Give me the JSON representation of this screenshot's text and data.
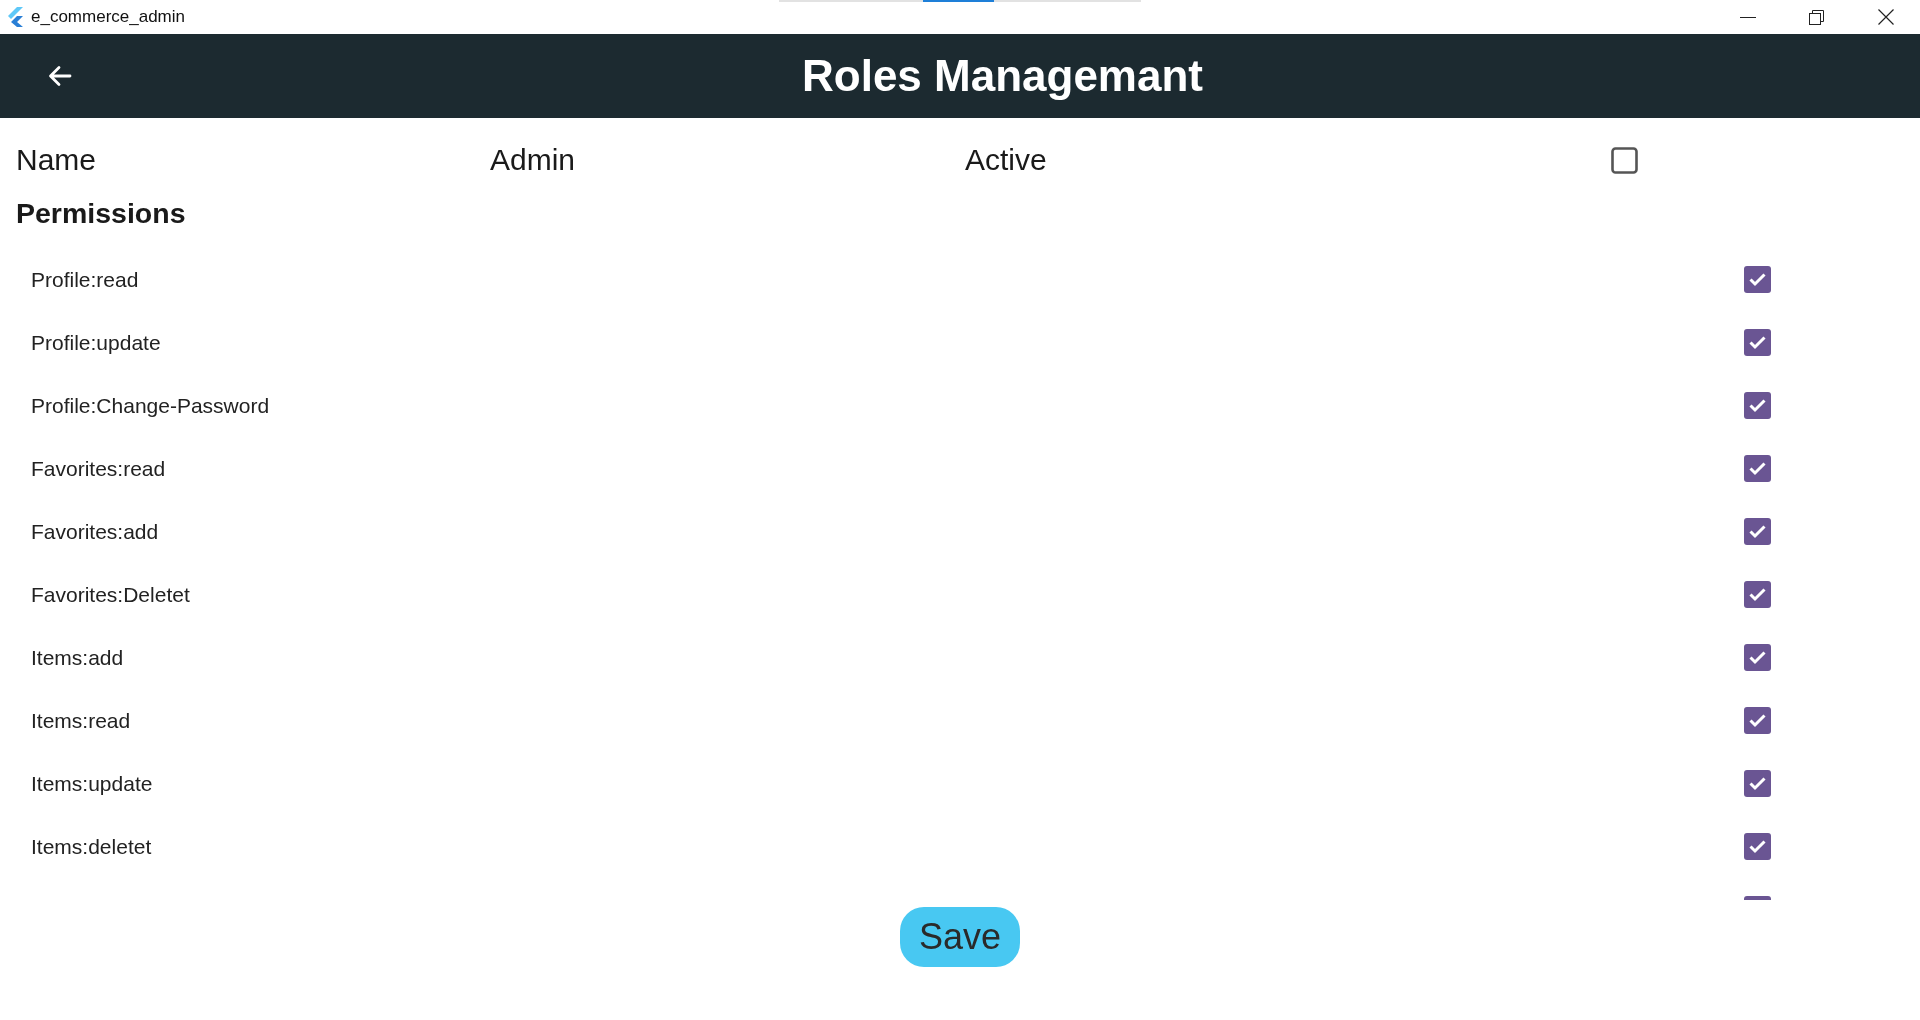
{
  "window": {
    "title": "e_commerce_admin"
  },
  "app_bar": {
    "title": "Roles Managemant"
  },
  "role": {
    "name_label": "Name",
    "name_value": "Admin",
    "active_label": "Active",
    "active": false
  },
  "permissions": {
    "heading": "Permissions",
    "items": [
      {
        "label": "Profile:read",
        "checked": true
      },
      {
        "label": "Profile:update",
        "checked": true
      },
      {
        "label": "Profile:Change-Password",
        "checked": true
      },
      {
        "label": "Favorites:read",
        "checked": true
      },
      {
        "label": "Favorites:add",
        "checked": true
      },
      {
        "label": "Favorites:Deletet",
        "checked": true
      },
      {
        "label": "Items:add",
        "checked": true
      },
      {
        "label": "Items:read",
        "checked": true
      },
      {
        "label": "Items:update",
        "checked": true
      },
      {
        "label": "Items:deletet",
        "checked": true
      },
      {
        "checked": true
      }
    ]
  },
  "buttons": [
    {
      "label": "Save"
    }
  ]
}
